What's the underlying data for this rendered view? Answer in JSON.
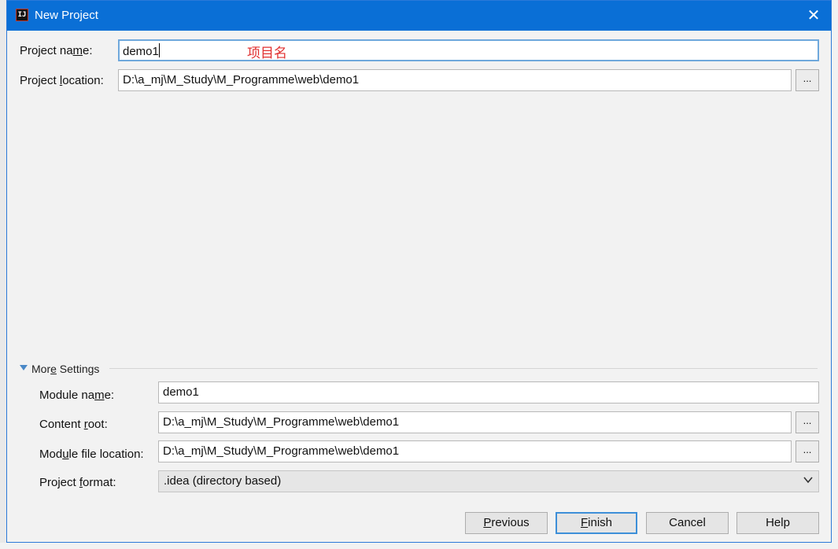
{
  "dialog": {
    "title": "New Project",
    "app_icon": "intellij-icon",
    "close_icon": "close-icon"
  },
  "project": {
    "name_label": "Project name:",
    "name_value": "demo1",
    "annotation": "项目名",
    "location_label": "Project location:",
    "location_value": "D:\\a_mj\\M_Study\\M_Programme\\web\\demo1",
    "browse_label": "..."
  },
  "more_settings": {
    "title": "More Settings",
    "module_name_label": "Module name:",
    "module_name_value": "demo1",
    "content_root_label": "Content root:",
    "content_root_value": "D:\\a_mj\\M_Study\\M_Programme\\web\\demo1",
    "module_file_label": "Module file location:",
    "module_file_value": "D:\\a_mj\\M_Study\\M_Programme\\web\\demo1",
    "format_label": "Project format:",
    "format_value": ".idea (directory based)",
    "browse_label": "..."
  },
  "buttons": {
    "previous": "Previous",
    "finish": "Finish",
    "cancel": "Cancel",
    "help": "Help"
  },
  "colors": {
    "title_bar": "#0a6fd6",
    "annotation": "#e03030",
    "focus_border": "#6fa8dc"
  }
}
